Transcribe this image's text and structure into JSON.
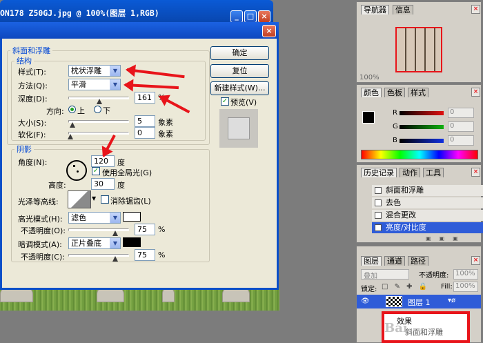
{
  "document": {
    "title": "ON178 Z50GJ.jpg @ 100%(图层 1,RGB)",
    "controls": [
      "_",
      "□",
      "×"
    ]
  },
  "dialog": {
    "close": "×",
    "bevel_group": "斜面和浮雕",
    "structure_group": "结构",
    "style_label": "样式(T):",
    "style_value": "枕状浮雕",
    "technique_label": "方法(Q):",
    "technique_value": "平滑",
    "depth_label": "深度(D):",
    "depth_value": "161",
    "depth_unit": "%",
    "direction_label": "方向:",
    "dir_up": "上",
    "dir_down": "下",
    "size_label": "大小(S):",
    "size_value": "5",
    "size_unit": "象素",
    "soften_label": "软化(F):",
    "soften_value": "0",
    "soften_unit": "象素",
    "shading_group": "阴影",
    "angle_label": "角度(N):",
    "angle_value": "120",
    "angle_unit": "度",
    "global_light": "使用全局光(G)",
    "altitude_label": "高度:",
    "altitude_value": "30",
    "altitude_unit": "度",
    "gloss_label": "光泽等高线:",
    "antialias": "消除锯齿(L)",
    "highlight_mode_label": "高光模式(H):",
    "highlight_mode_value": "滤色",
    "highlight_opacity_label": "不透明度(O):",
    "highlight_opacity_value": "75",
    "shadow_mode_label": "暗调模式(A):",
    "shadow_mode_value": "正片叠底",
    "shadow_opacity_label": "不透明度(C):",
    "shadow_opacity_value": "75",
    "percent": "%",
    "ok": "确定",
    "reset": "复位",
    "new_style": "新建样式(W)...",
    "preview": "预览(V)",
    "colors": {
      "highlight": "#ffffff",
      "shadow": "#000000"
    }
  },
  "navigator": {
    "tabs": [
      "导航器",
      "信息"
    ],
    "zoom": "100%"
  },
  "color_panel": {
    "tabs": [
      "颜色",
      "色板",
      "样式"
    ],
    "channels": [
      {
        "name": "R",
        "value": "0",
        "color": "#e01010"
      },
      {
        "name": "G",
        "value": "0",
        "color": "#10b010"
      },
      {
        "name": "B",
        "value": "0",
        "color": "#1030e0"
      }
    ]
  },
  "history": {
    "tabs": [
      "历史记录",
      "动作",
      "工具"
    ],
    "items": [
      "斜面和浮雕",
      "去色",
      "混合更改",
      "亮度/对比度"
    ]
  },
  "layers": {
    "tabs": [
      "图层",
      "通道",
      "路径"
    ],
    "blend_mode": "叠加",
    "opacity_label": "不透明度:",
    "opacity_value": "100%",
    "lock_label": "锁定:",
    "fill_label": "Fill:",
    "fill_value": "100%",
    "layer_name": "图层 1",
    "effects_label": "效果",
    "effect_item": "斜面和浮雕",
    "watermark": "Bai"
  }
}
